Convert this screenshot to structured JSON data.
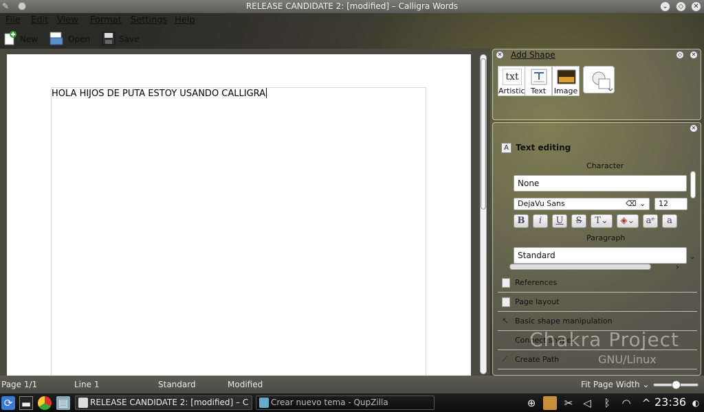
{
  "window": {
    "title": "RELEASE CANDIDATE 2:  [modified] – Calligra Words"
  },
  "menu": [
    "File",
    "Edit",
    "View",
    "Format",
    "Settings",
    "Help"
  ],
  "toolbar": {
    "new_label": "New",
    "open_label": "Open",
    "save_label": "Save"
  },
  "document": {
    "text": "HOLA HIJOS DE PUTA ESTOY USANDO CALLIGRA"
  },
  "add_shape": {
    "title": "Add Shape",
    "tiles": [
      {
        "label": "Artistic",
        "icon": "artistic-text-icon",
        "glyph": "txt"
      },
      {
        "label": "Text",
        "icon": "text-shape-icon"
      },
      {
        "label": "Image",
        "icon": "image-shape-icon"
      }
    ]
  },
  "text_editing": {
    "title": "Text editing",
    "character_header": "Character",
    "character_style": "None",
    "font_family": "DejaVu Sans",
    "font_size": "12",
    "paragraph_header": "Paragraph",
    "paragraph_style": "Standard"
  },
  "tools": [
    {
      "label": "References",
      "icon": "references-icon"
    },
    {
      "label": "Page layout",
      "icon": "page-layout-icon"
    },
    {
      "label": "Basic shape manipulation",
      "icon": "pointer-icon"
    },
    {
      "label": "Connect shapes",
      "icon": "connect-icon"
    },
    {
      "label": "Create Path",
      "icon": "path-icon"
    }
  ],
  "watermark": {
    "title": "Chakra Project",
    "subtitle": "GNU/Linux"
  },
  "status": {
    "page": "Page 1/1",
    "line": "Line 1",
    "style": "Standard",
    "state": "Modified",
    "zoom": "Fit Page Width",
    "zoom_level": 0.5
  },
  "taskbar": {
    "tasks": [
      {
        "label": "RELEASE CANDIDATE 2:  [modified] – C"
      },
      {
        "label": "Crear nuevo tema - QupZilla"
      }
    ],
    "clock": "23:36"
  }
}
